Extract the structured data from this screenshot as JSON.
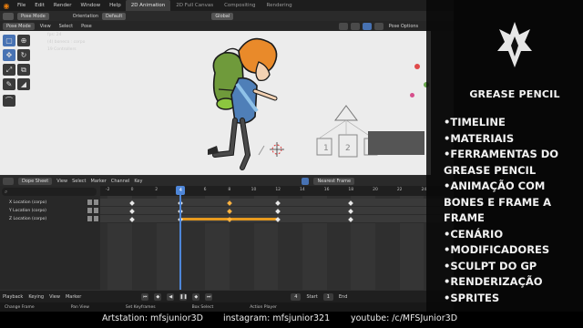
{
  "topbar": {
    "menu": [
      "File",
      "Edit",
      "Render",
      "Window",
      "Help"
    ],
    "workspaces": [
      "2D Animation",
      "2D Full Canvas",
      "Compositing",
      "Rendering"
    ],
    "active_workspace": "2D Animation"
  },
  "viewport_header": {
    "mode": "Pose Mode",
    "orientation_label": "Orientation",
    "orientation_value": "Default",
    "transform_orientation": "Global",
    "menus": [
      "View",
      "Select",
      "Pose"
    ],
    "pose_options": "Pose Options"
  },
  "viewport": {
    "overlay_lines": [
      "fps: 24",
      "(4) boneco : corpo",
      "19 Controllers"
    ],
    "overlay_colors": [
      "#6a6a6a",
      "#c9a100",
      "#6a6a6a"
    ]
  },
  "dopesheet": {
    "mode": "Dope Sheet",
    "menus": [
      "View",
      "Select",
      "Marker",
      "Channel",
      "Key"
    ],
    "interpolation": "Nearest Frame",
    "channels": [
      "X Location (corpo)",
      "Y Location (corpo)",
      "Z Location (corpo)"
    ],
    "ruler_ticks": [
      "-2",
      "0",
      "2",
      "4",
      "6",
      "8",
      "10",
      "12",
      "14",
      "16",
      "18",
      "20",
      "22",
      "24"
    ],
    "current_frame": "4",
    "keyframes": [
      {
        "row": 0,
        "frames": [
          0,
          4,
          8,
          12,
          18
        ],
        "selected": [
          8
        ]
      },
      {
        "row": 1,
        "frames": [
          0,
          4,
          8,
          12,
          18
        ],
        "selected": [
          8
        ]
      },
      {
        "row": 2,
        "frames": [
          0,
          4,
          8,
          12,
          18
        ],
        "selected": [
          8
        ]
      }
    ],
    "hold": {
      "row": 2,
      "from": 4,
      "to": 12
    }
  },
  "playback": {
    "menus": [
      "Playback",
      "Keying",
      "View",
      "Marker"
    ],
    "current_frame": "4",
    "start_label": "Start",
    "start_value": "1",
    "end_label": "End"
  },
  "statusbar": {
    "items": [
      "Change Frame",
      "Pan View",
      "Set Keyframes",
      "Box Select",
      "Action Player"
    ]
  },
  "panel": {
    "title": "GREASE PENCIL",
    "topics": [
      "TIMELINE",
      "MATERIAIS",
      "FERRAMENTAS DO GREASE PENCIL",
      "ANIMAÇÃO COM BONES E FRAME A FRAME",
      "CENÁRIO",
      "MODIFICADORES",
      "SCULPT DO GP",
      "RENDERIZAÇÃO",
      "SPRITES"
    ]
  },
  "footer": {
    "artstation": "Artstation: mfsjunior3D",
    "instagram": "instagram: mfsjunior321",
    "youtube": "youtube: /c/MFSJunior3D"
  },
  "colors": {
    "accent": "#4772b3",
    "keyframe_selected": "#ffb340",
    "hold_bar": "#e79a1f",
    "playhead": "#4e86d8"
  }
}
